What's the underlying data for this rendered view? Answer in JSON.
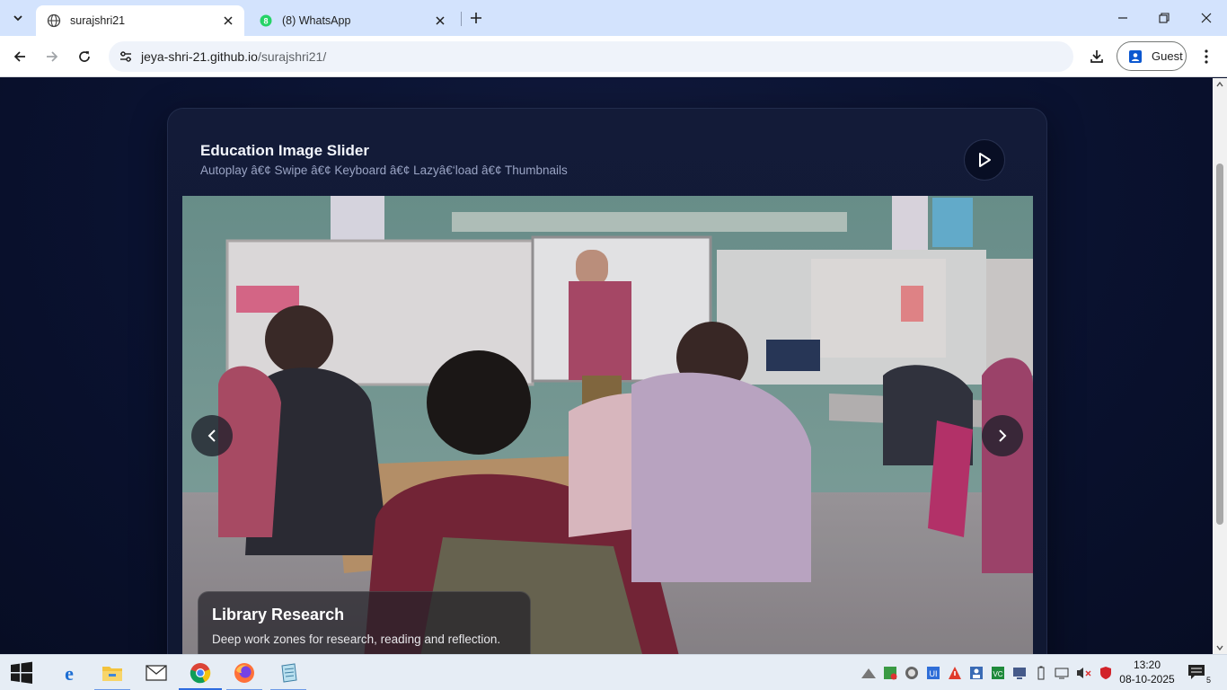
{
  "browser": {
    "tabs": [
      {
        "title": "surajshri21",
        "active": true
      },
      {
        "title": "(8) WhatsApp",
        "active": false
      }
    ],
    "url": {
      "host": "jeya-shri-21.github.io",
      "path": "/surajshri21/"
    },
    "profile_label": "Guest"
  },
  "slider": {
    "title": "Education Image Slider",
    "subtitle": "Autoplay â€¢ Swipe â€¢ Keyboard â€¢ Lazyâ€‘load â€¢ Thumbnails",
    "current_slide": {
      "title": "Library Research",
      "description": "Deep work zones for research, reading and reflection."
    }
  },
  "taskbar": {
    "apps": [
      "start",
      "edge",
      "file-explorer",
      "mail",
      "chrome",
      "firefox",
      "notepad"
    ],
    "clock": {
      "time": "13:20",
      "date": "08-10-2025"
    },
    "notification_count": "5"
  },
  "colors": {
    "page_bg": "#0b1330",
    "card_bg": "#131b38",
    "tab_strip": "#d3e3fd",
    "taskbar": "#e6edf5"
  }
}
